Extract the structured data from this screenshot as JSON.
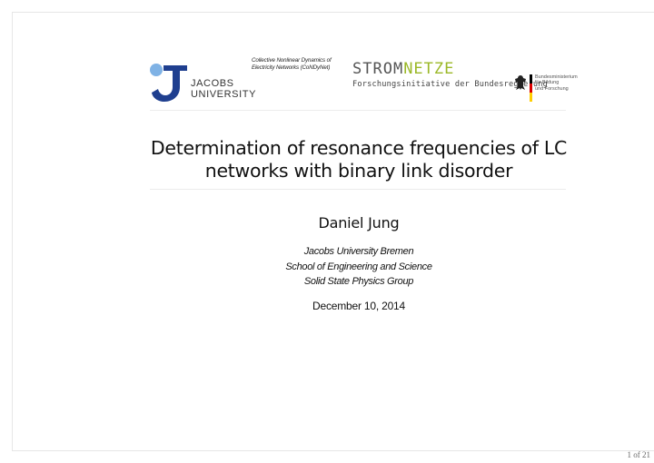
{
  "header": {
    "jacobs_logo_line1": "JACOBS",
    "jacobs_logo_line2": "UNIVERSITY",
    "collective_line1": "Collective Nonlinear Dynamics of",
    "collective_line2": "Electricity Networks (CoNDyNet)",
    "stromnetze_part1": "STROM",
    "stromnetze_part2": "NETZE",
    "stromnetze_subtitle": "Forschungsinitiative der Bundesregierung",
    "bmbf_line1": "Bundesministerium",
    "bmbf_line2": "für Bildung",
    "bmbf_line3": "und Forschung",
    "colors": {
      "jacobs_blue": "#1f3f8f",
      "jacobs_light": "#7fb2e5",
      "stromnetze_green": "#9bb827"
    }
  },
  "slide": {
    "title_line1": "Determination of resonance frequencies of LC",
    "title_line2": "networks with binary link disorder",
    "author": "Daniel Jung",
    "affiliation": [
      "Jacobs University Bremen",
      "School of Engineering and Science",
      "Solid State Physics Group"
    ],
    "date": "December 10, 2014"
  },
  "footer": {
    "page": "1 of 21"
  }
}
